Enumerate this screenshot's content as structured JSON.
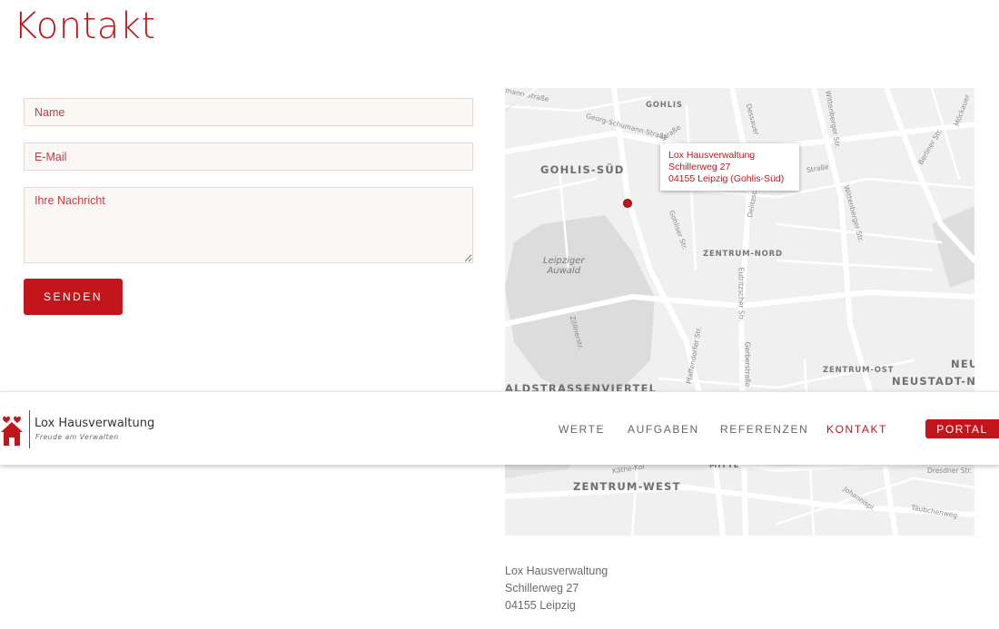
{
  "page": {
    "title": "Kontakt"
  },
  "form": {
    "name_placeholder": "Name",
    "email_placeholder": "E-Mail",
    "message_placeholder": "Ihre Nachricht",
    "submit_label": "SENDEN"
  },
  "map": {
    "info_window": {
      "line1": "Lox Hausverwaltung",
      "line2": "Schillerweg 27",
      "line3": "04155 Leipzig (Gohlis-Süd)"
    },
    "districts": {
      "gohlis": "GOHLIS",
      "gohlis_sued": "GOHLIS-SÜD",
      "zentrum_nord": "ZENTRUM-NORD",
      "zentrum_ost": "ZENTRUM-OST",
      "neustadt": "NEUSTADT-NE",
      "neu": "NEU",
      "waldstrassenviertel": "ALDSTRASSENVIERTEL",
      "zentrum_west": "ZENTRUM-WEST",
      "mitte": "MITTE"
    },
    "park_line1": "Leipziger",
    "park_line2": "Auwald",
    "streets": {
      "s1": "mann-Straße",
      "s2": "Georg-Schumann-Straße",
      "s3": "Gohliser Str.",
      "s4": "Dessauer",
      "s5": "Wittenberger Str.",
      "s6": "Eutritzscher Str.",
      "s7": "Pfaffendorfer Str.",
      "s8": "Gerberstraße",
      "s9": "Zöllnerstr.",
      "s10": "Berliner Str.",
      "s11": "Delitzscher Str.",
      "s12": "Käthe-Kol",
      "s13": "Dresdner Str.",
      "s14": "Johannispl.",
      "s15": "Täubchenweg",
      "s16": "Möckauer",
      "s17": "Straße",
      "s18": "Straße"
    }
  },
  "address": {
    "line1": "Lox Hausverwaltung",
    "line2": "Schillerweg 27",
    "line3": "04155 Leipzig"
  },
  "header": {
    "logo_name": "Lox Hausverwaltung",
    "logo_tagline": "Freude am Verwalten",
    "nav": [
      {
        "label": "WERTE"
      },
      {
        "label": "AUFGABEN"
      },
      {
        "label": "REFERENZEN"
      },
      {
        "label": "KONTAKT"
      }
    ],
    "portal_label": "PORTAL"
  },
  "colors": {
    "brand_red": "#c0151b",
    "field_background": "#fbf7f4",
    "map_background": "#f0f0f0"
  },
  "icons": {
    "logo": "house-heart-icon",
    "map_marker": "map-marker-icon"
  }
}
